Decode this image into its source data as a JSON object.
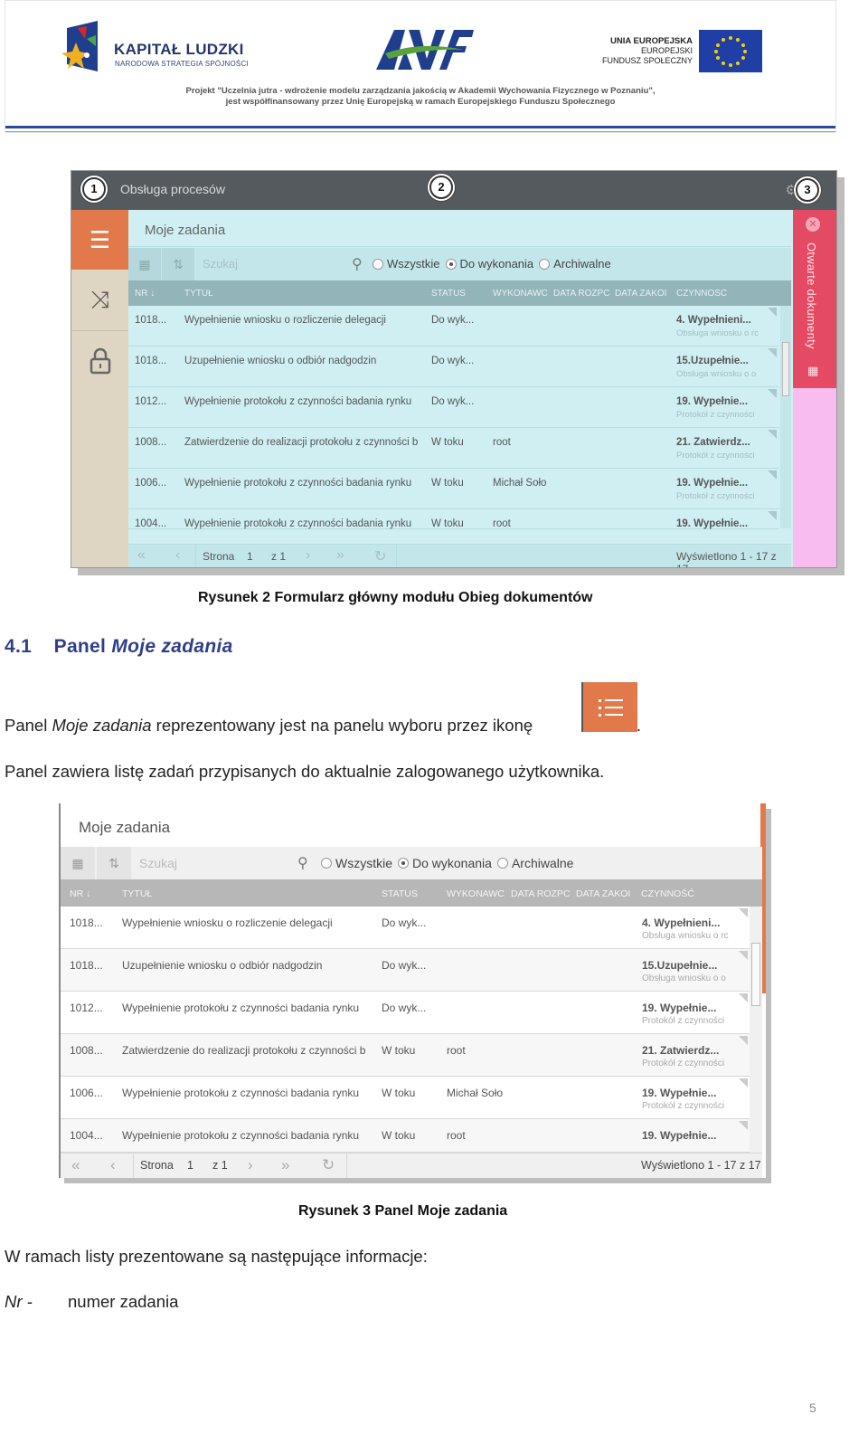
{
  "banner": {
    "kl_title": "KAPITAŁ LUDZKI",
    "kl_subtitle": "NARODOWA STRATEGIA SPÓJNOŚCI",
    "eu_line1": "UNIA EUROPEJSKA",
    "eu_line2": "EUROPEJSKI",
    "eu_line3": "FUNDUSZ SPOŁECZNY",
    "project_line1": "Projekt \"Uczelnia jutra - wdrożenie modelu zarządzania jakością w Akademii Wychowania Fizycznego w Poznaniu\",",
    "project_line2": "jest współfinansowany przez Unię Europejską w ramach Europejskiego Funduszu Społecznego",
    "colors": {
      "brand_blue": "#2b4a9b",
      "eu_blue": "#1f3fa6",
      "awf_green": "#5aa23c"
    }
  },
  "app": {
    "title": "Obsługa procesów",
    "callouts": [
      "1",
      "2",
      "3"
    ],
    "panel_title": "Moje zadania",
    "search_placeholder": "Szukaj",
    "radios": [
      {
        "label": "Wszystkie",
        "checked": false
      },
      {
        "label": "Do wykonania",
        "checked": true
      },
      {
        "label": "Archiwalne",
        "checked": false
      }
    ],
    "right_panel_label": "Otwarte dokumenty",
    "colors": {
      "titlebar": "#555a5e",
      "sidebar_active": "#e2794b",
      "right_panel": "#e44a64",
      "panel_bg": "#cfeff2"
    }
  },
  "table": {
    "columns": {
      "nr": "NR",
      "tytul": "TYTUŁ",
      "status": "STATUS",
      "wykonawca": "WYKONAWC",
      "data_rozp": "DATA ROZPC",
      "data_zak": "DATA ZAKOI",
      "czynnosc": "CZYNNOŚĆ"
    },
    "rows": [
      {
        "nr": "1018...",
        "tytul": "Wypełnienie wniosku o rozliczenie delegacji",
        "status": "Do wyk...",
        "wykonawca": "",
        "czynnosc": "4. Wypełnieni...",
        "czynnosc_sub": "Obsługa wniosku o rc"
      },
      {
        "nr": "1018...",
        "tytul": "Uzupełnienie wniosku o odbiór nadgodzin",
        "status": "Do wyk...",
        "wykonawca": "",
        "czynnosc": "15.Uzupełnie...",
        "czynnosc_sub": "Obsługa wniosku o o"
      },
      {
        "nr": "1012...",
        "tytul": "Wypełnienie protokołu z czynności badania rynku",
        "status": "Do wyk...",
        "wykonawca": "",
        "czynnosc": "19. Wypełnie...",
        "czynnosc_sub": "Protokół z czynności"
      },
      {
        "nr": "1008...",
        "tytul": "Zatwierdzenie do realizacji protokołu z czynności b",
        "status": "W toku",
        "wykonawca": "root",
        "czynnosc": "21. Zatwierdz...",
        "czynnosc_sub": "Protokół z czynności"
      },
      {
        "nr": "1006...",
        "tytul": "Wypełnienie protokołu z czynności badania rynku",
        "status": "W toku",
        "wykonawca": "Michał Soło",
        "czynnosc": "19. Wypełnie...",
        "czynnosc_sub": "Protokół z czynności"
      },
      {
        "nr": "1004...",
        "tytul": "Wypełnienie protokołu z czynności badania rynku",
        "status": "W toku",
        "wykonawca": "root",
        "czynnosc": "19. Wypełnie...",
        "czynnosc_sub": ""
      }
    ],
    "pager": {
      "page_label": "Strona",
      "page_value": "1",
      "of_total": "z 1",
      "summary": "Wyświetlono 1 - 17 z 17"
    }
  },
  "doc": {
    "caption1": "Rysunek 2 Formularz główny modułu Obieg dokumentów",
    "section_number": "4.1",
    "section_title_plain": "Panel",
    "section_title_italic": "Moje zadania",
    "para1_start": "Panel",
    "para1_italic": "Moje zadania",
    "para1_rest": "reprezentowany jest na panelu wyboru przez ikonę",
    "para1_end": ".",
    "para2": "Panel zawiera listę zadań przypisanych do aktualnie zalogowanego użytkownika.",
    "caption2": "Rysunek 3 Panel Moje zadania",
    "para3": "W ramach listy prezentowane są następujące informacje:",
    "nr_label": "Nr -",
    "nr_desc": "numer zadania",
    "page_number": "5"
  }
}
